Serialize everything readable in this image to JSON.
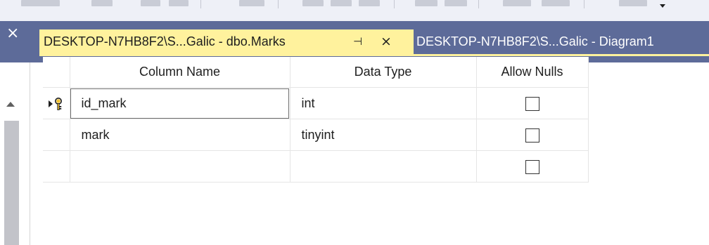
{
  "toolbar": {
    "dropdown_icon": "chevron-down-icon"
  },
  "left_panel": {
    "close_label": "×",
    "scroll_icon": "scroll-up-arrow-icon"
  },
  "tabs": [
    {
      "title": "DESKTOP-N7HB8F2\\S...Galic - dbo.Marks",
      "pin_label": "⊣",
      "close_label": "×",
      "active": true
    },
    {
      "title": "DESKTOP-N7HB8F2\\S...Galic - Diagram1",
      "active": false
    }
  ],
  "grid": {
    "columns": [
      "Column Name",
      "Data Type",
      "Allow Nulls"
    ],
    "rows": [
      {
        "name": "id_mark",
        "type": "int",
        "allow_nulls": false,
        "primary_key": true
      },
      {
        "name": "mark",
        "type": "tinyint",
        "allow_nulls": false,
        "primary_key": false
      },
      {
        "name": "",
        "type": "",
        "allow_nulls": false,
        "primary_key": false
      }
    ]
  },
  "colors": {
    "tab_bar": "#5d6b99",
    "active_tab": "#fff29d",
    "key_icon": "#d4a017"
  }
}
